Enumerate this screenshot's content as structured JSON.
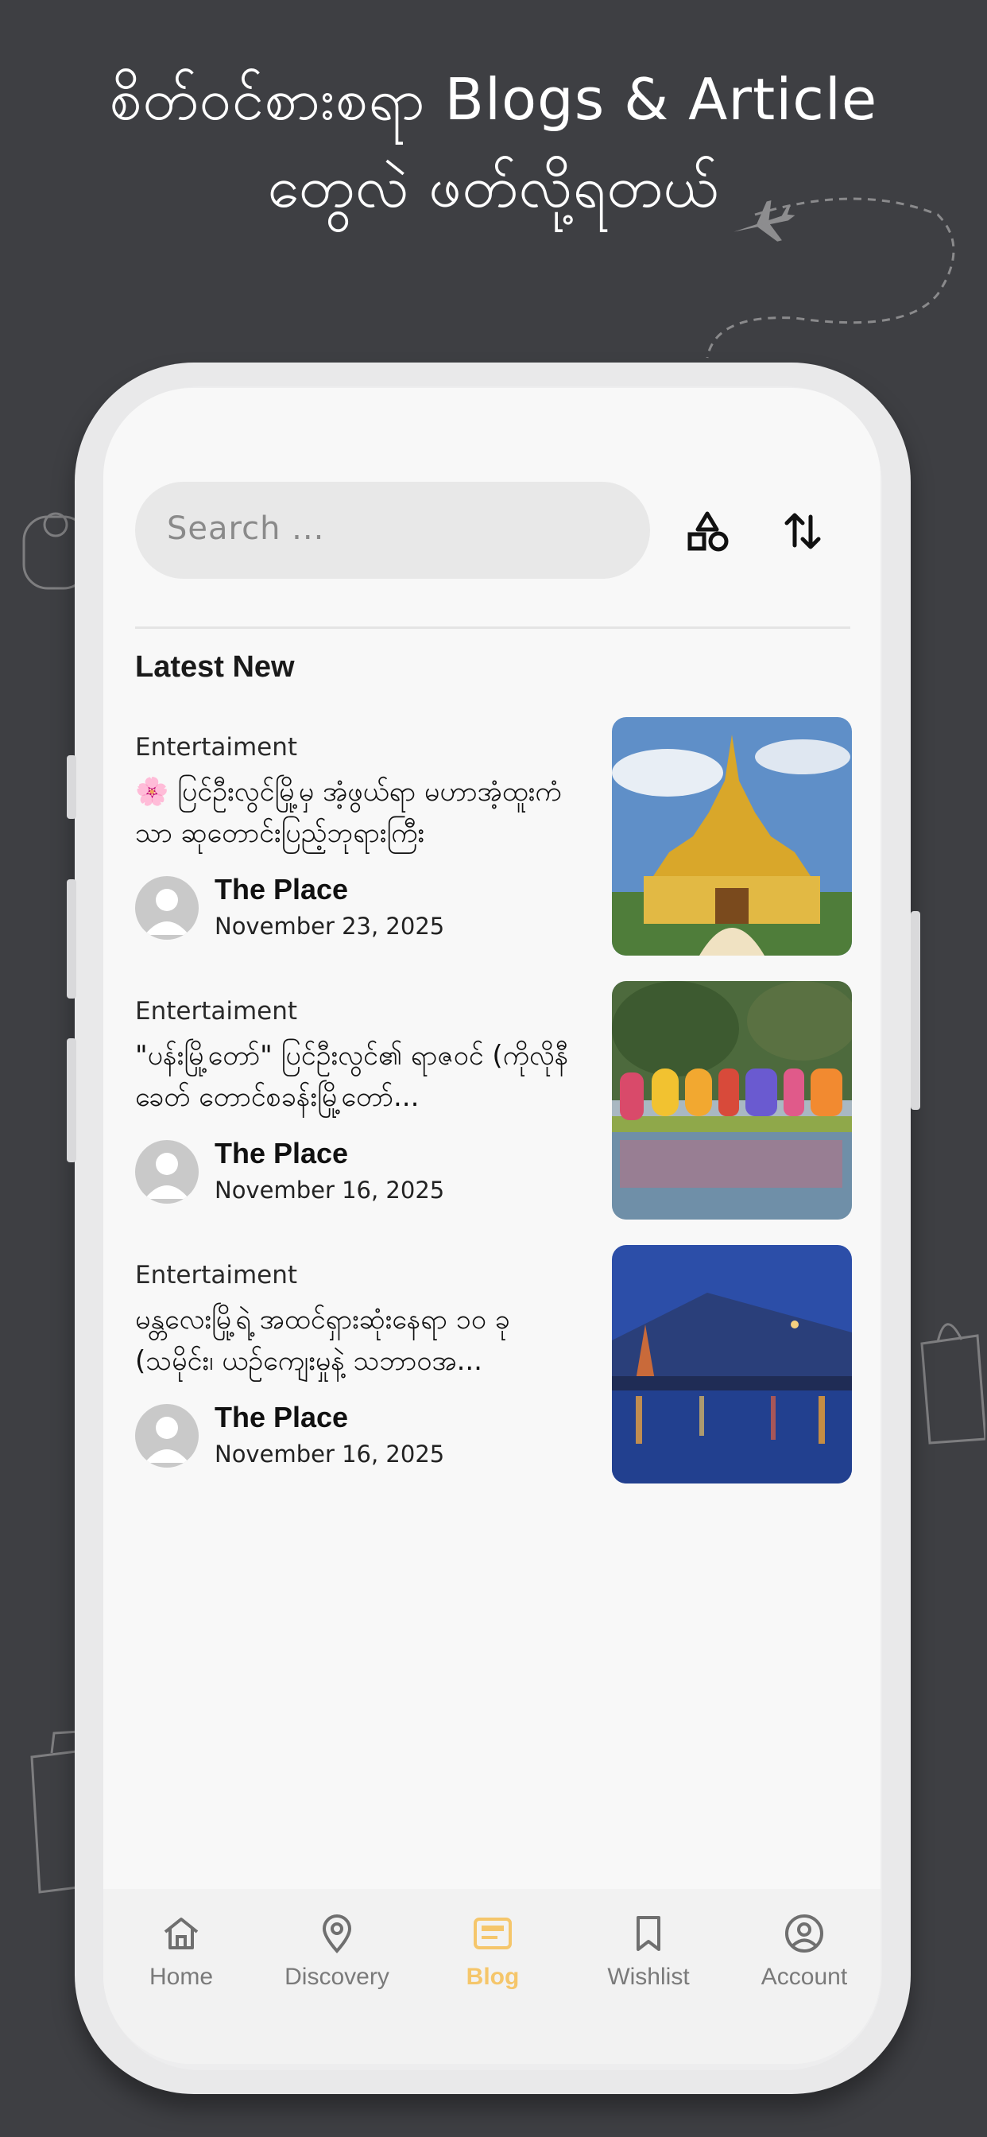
{
  "headline": {
    "line1": "စိတ်ဝင်စားစရာ Blogs & Article",
    "line2": "တွေလဲ ဖတ်လို့ရတယ်"
  },
  "search": {
    "placeholder": "Search ..."
  },
  "toolbar": {
    "filter_icon": "shapes-icon",
    "sort_icon": "sort-arrows-icon"
  },
  "section": {
    "title": "Latest New"
  },
  "articles": [
    {
      "category": "Entertaiment",
      "title": "🌸 ပြင်ဦးလွင်မြို့မှ အံ့ဖွယ်ရာ မဟာအံ့ထူးကံသာ ဆုတောင်းပြည့်ဘုရားကြီး",
      "author": "The Place",
      "date": "November 23, 2025",
      "image": "golden-pagoda"
    },
    {
      "category": "Entertaiment",
      "title": "\"ပန်းမြို့တော်\" ပြင်ဦးလွင်၏ ရာဇဝင် (ကိုလိုနီခေတ် တောင်စခန်းမြို့တော်...",
      "author": "The Place",
      "date": "November 16, 2025",
      "image": "lake-letters"
    },
    {
      "category": "Entertaiment",
      "title": "မန္တလေးမြို့ရဲ့ အထင်ရှားဆုံးနေရာ ၁၀ ခု (သမိုင်း၊ ယဉ်ကျေးမှုနဲ့ သဘာဝအ...",
      "author": "The Place",
      "date": "November 16, 2025",
      "image": "palace-night"
    }
  ],
  "nav": {
    "items": [
      {
        "label": "Home",
        "icon": "home-icon"
      },
      {
        "label": "Discovery",
        "icon": "location-pin-icon"
      },
      {
        "label": "Blog",
        "icon": "blog-icon",
        "active": true
      },
      {
        "label": "Wishlist",
        "icon": "bookmark-icon"
      },
      {
        "label": "Account",
        "icon": "account-icon"
      }
    ]
  },
  "colors": {
    "background": "#3e3f43",
    "accent": "#f5c66b",
    "screen": "#f8f8f8"
  }
}
